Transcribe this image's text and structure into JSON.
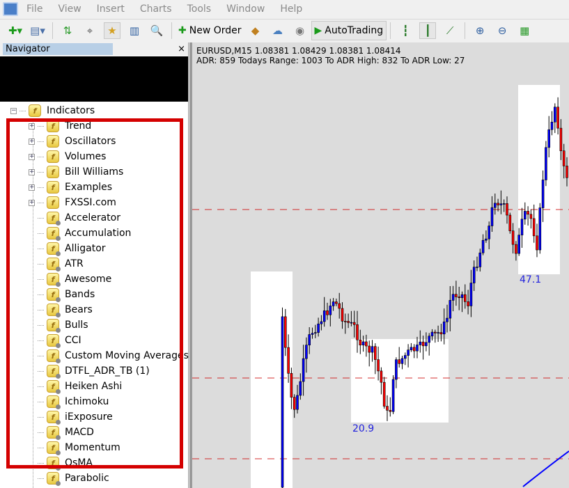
{
  "menu": [
    "File",
    "View",
    "Insert",
    "Charts",
    "Tools",
    "Window",
    "Help"
  ],
  "toolbar": {
    "new_order": "New Order",
    "autotrading": "AutoTrading"
  },
  "navigator": {
    "title": "Navigator",
    "close": "×",
    "root": "Indicators",
    "folders": [
      "Trend",
      "Oscillators",
      "Volumes",
      "Bill Williams",
      "Examples",
      "FXSSI.com"
    ],
    "items": [
      "Accelerator",
      "Accumulation",
      "Alligator",
      "ATR",
      "Awesome",
      "Bands",
      "Bears",
      "Bulls",
      "CCI",
      "Custom Moving Averages",
      "DTFL_ADR_TB  (1)",
      "Heiken Ashi",
      "Ichimoku",
      "iExposure",
      "MACD",
      "Momentum",
      "OsMA",
      "Parabolic"
    ]
  },
  "chart": {
    "symbol_line": "EURUSD,M15  1.08381 1.08429 1.08381 1.08414",
    "adr_line": "ADR: 859   Todays Range: 1003   To ADR High: 832   To ADR Low: 27",
    "box_labels": [
      "20.9",
      "47.1"
    ],
    "colors": {
      "bull": "#0000ff",
      "bear": "#ff0000",
      "background": "#dcdcdc",
      "highlight": "#ffffff",
      "level": "#cc0000"
    }
  }
}
